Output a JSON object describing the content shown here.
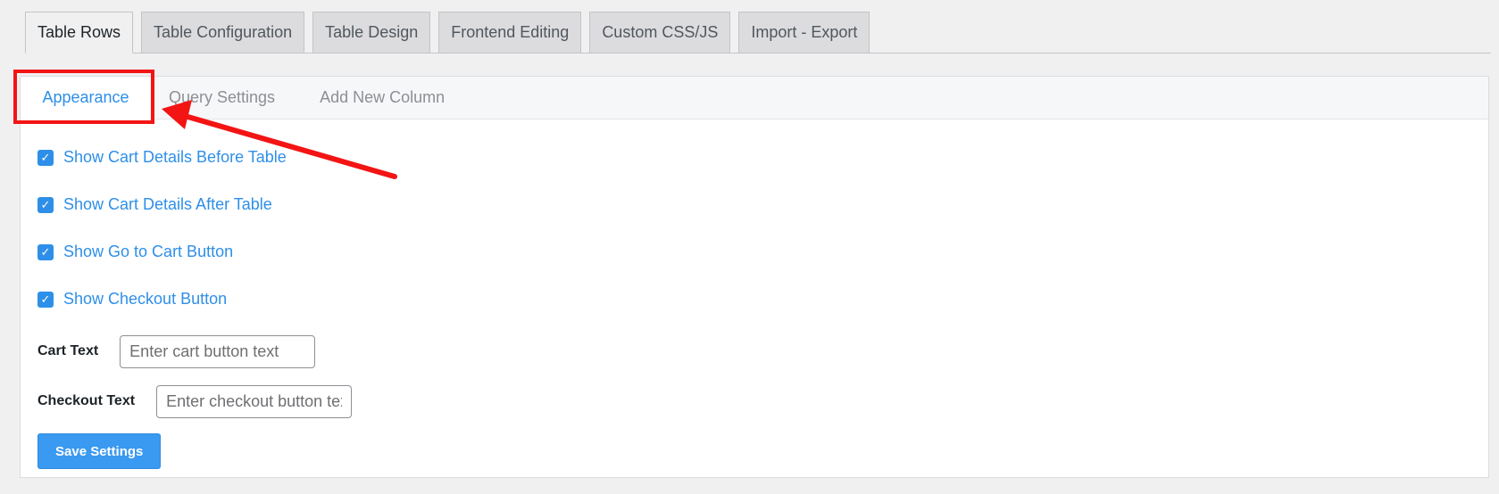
{
  "nav_tabs": [
    {
      "label": "Table Rows",
      "active": true
    },
    {
      "label": "Table Configuration",
      "active": false
    },
    {
      "label": "Table Design",
      "active": false
    },
    {
      "label": "Frontend Editing",
      "active": false
    },
    {
      "label": "Custom CSS/JS",
      "active": false
    },
    {
      "label": "Import - Export",
      "active": false
    }
  ],
  "sub_tabs": [
    {
      "label": "Appearance",
      "active": true
    },
    {
      "label": "Query Settings",
      "active": false
    },
    {
      "label": "Add New Column",
      "active": false
    }
  ],
  "options": [
    {
      "label": "Show Cart Details Before Table",
      "checked": true
    },
    {
      "label": "Show Cart Details After Table",
      "checked": true
    },
    {
      "label": "Show Go to Cart Button",
      "checked": true
    },
    {
      "label": "Show Checkout Button",
      "checked": true
    }
  ],
  "fields": {
    "cart_text": {
      "label": "Cart Text",
      "value": "",
      "placeholder": "Enter cart button text"
    },
    "checkout_text": {
      "label": "Checkout Text",
      "value": "",
      "placeholder": "Enter checkout button text"
    }
  },
  "save_button": {
    "label": "Save Settings"
  },
  "colors": {
    "accent": "#2e8fe8",
    "annotation": "#f31414"
  },
  "icons": {
    "checkbox_mark": "check-icon"
  }
}
